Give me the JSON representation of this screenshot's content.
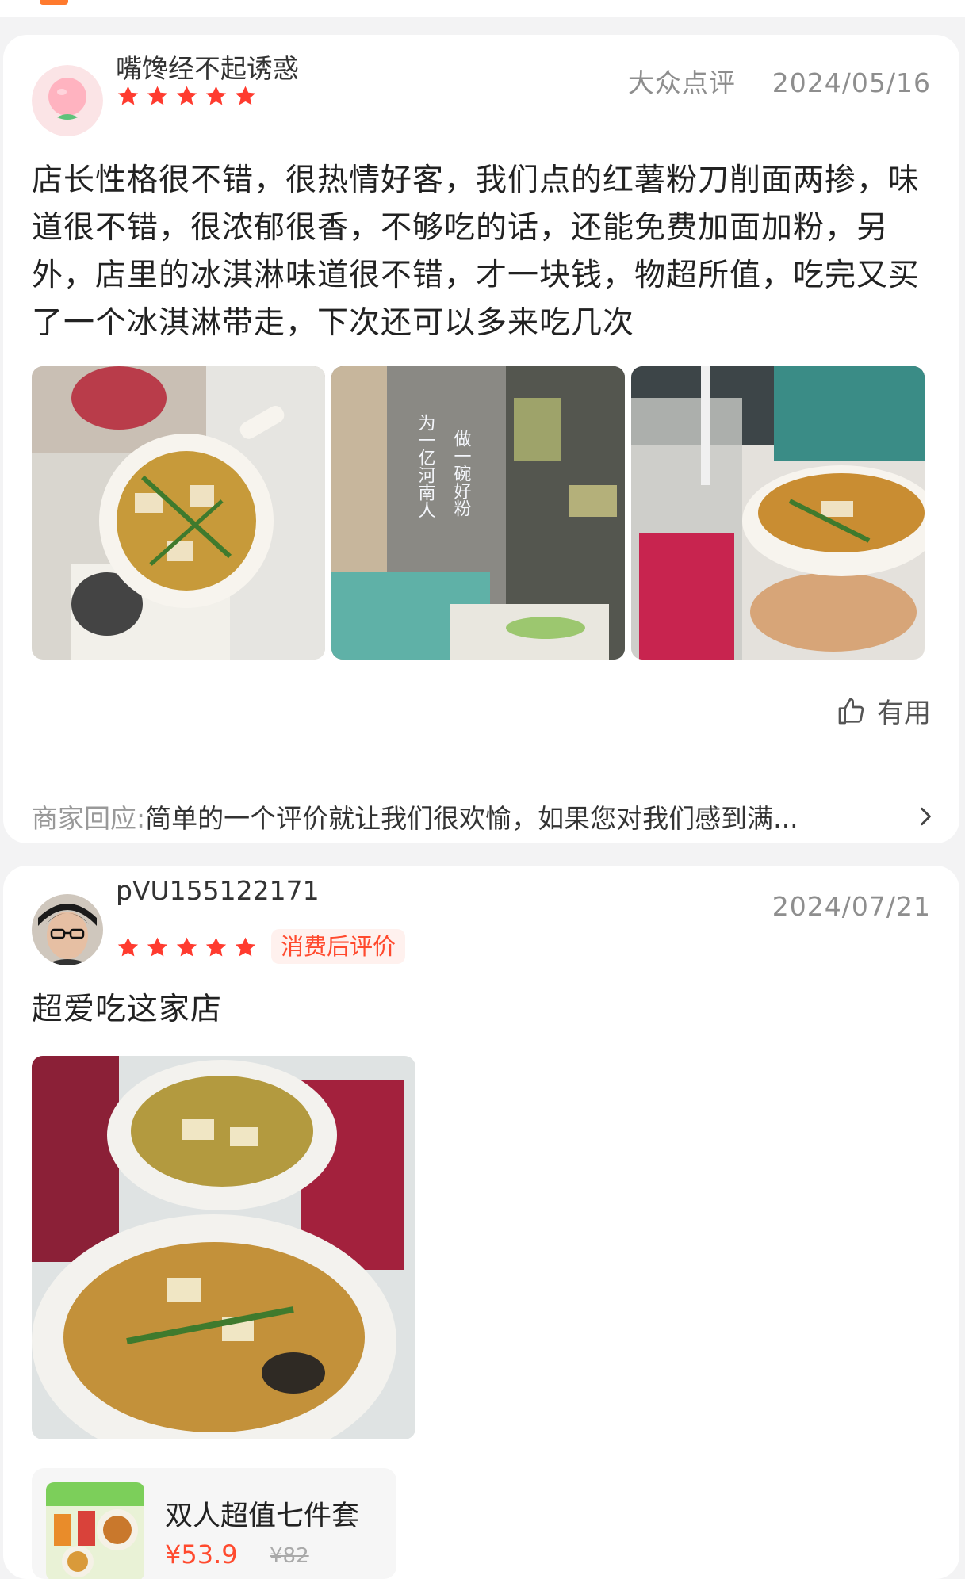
{
  "reviews": [
    {
      "username": "嘴馋经不起诱惑",
      "source": "大众点评",
      "date": "2024/05/16",
      "rating": 5,
      "text": "店长性格很不错，很热情好客，我们点的红薯粉刀削面两掺，味道很不错，很浓郁很香，不够吃的话，还能免费加面加粉，另外，店里的冰淇淋味道很不错，才一块钱，物超所值，吃完又买了一个冰淇淋带走，下次还可以多来吃几次",
      "photos": [
        "soup-bowl-photo",
        "restaurant-interior-photo",
        "soup-and-drink-photo"
      ],
      "interior_sign": [
        "为一亿河南人",
        "做一碗好粉"
      ],
      "useful_label": "有用",
      "merchant_reply_prefix": "商家回应:",
      "merchant_reply": "简单的一个评价就让我们很欢愉，如果您对我们感到满..."
    },
    {
      "username": "pVU155122171",
      "date": "2024/07/21",
      "rating": 5,
      "badge": "消费后评价",
      "text": "超爱吃这家店",
      "photos": [
        "two-bowls-photo"
      ],
      "product": {
        "name": "双人超值七件套",
        "price": "¥53.9",
        "original_price": "¥82"
      }
    }
  ],
  "colors": {
    "star": "#ff3b2f",
    "accent": "#ff4a2e",
    "meta_text": "#8e8e8e"
  }
}
